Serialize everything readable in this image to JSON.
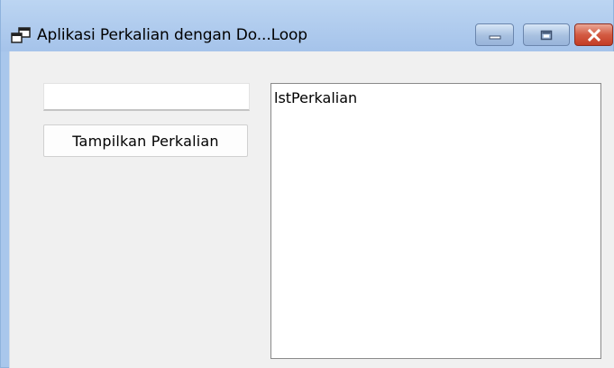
{
  "window": {
    "title": "Aplikasi Perkalian dengan Do...Loop",
    "controls": {
      "minimize_icon": "minimize-icon",
      "maximize_icon": "maximize-icon",
      "close_icon": "close-icon"
    }
  },
  "form": {
    "input": {
      "value": "",
      "placeholder": ""
    },
    "show_button_label": "Tampilkan Perkalian",
    "listbox": {
      "items": [
        "lstPerkalian"
      ]
    }
  },
  "colors": {
    "title_bar": "#a9c7ec",
    "client_background": "#f0f0f0",
    "close_button": "#c43c24"
  }
}
